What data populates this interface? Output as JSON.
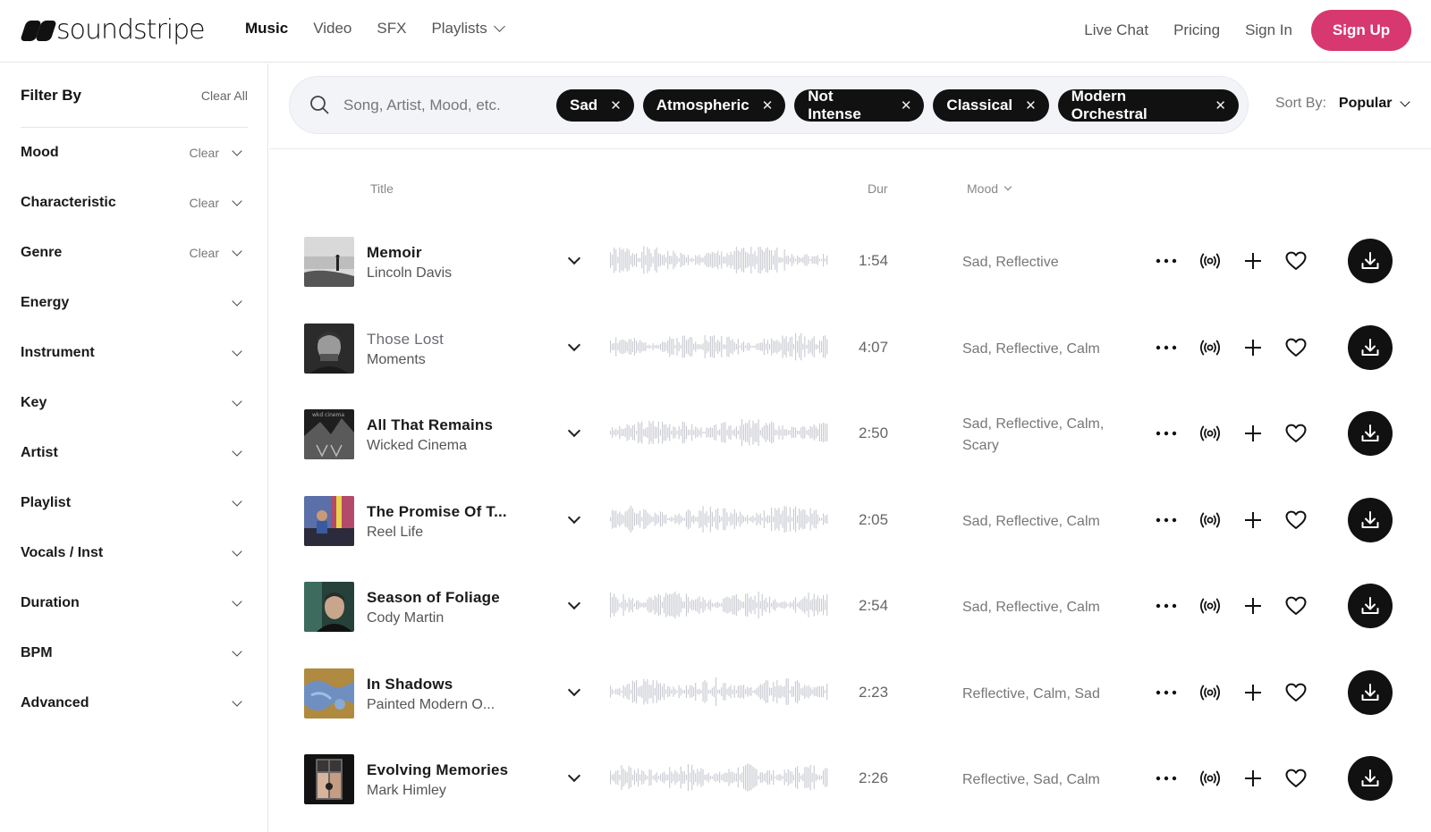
{
  "brand": {
    "name": "soundstripe"
  },
  "nav": {
    "items": [
      "Music",
      "Video",
      "SFX",
      "Playlists"
    ],
    "right": [
      "Live Chat",
      "Pricing",
      "Sign In"
    ],
    "signup": "Sign Up"
  },
  "colors": {
    "accent": "#d6386f",
    "chip": "#111111"
  },
  "sidebar": {
    "title": "Filter By",
    "clear_all": "Clear All",
    "filters": [
      {
        "label": "Mood",
        "clear": "Clear"
      },
      {
        "label": "Characteristic",
        "clear": "Clear"
      },
      {
        "label": "Genre",
        "clear": "Clear"
      },
      {
        "label": "Energy"
      },
      {
        "label": "Instrument"
      },
      {
        "label": "Key"
      },
      {
        "label": "Artist"
      },
      {
        "label": "Playlist"
      },
      {
        "label": "Vocals / Inst"
      },
      {
        "label": "Duration"
      },
      {
        "label": "BPM"
      },
      {
        "label": "Advanced"
      }
    ]
  },
  "search": {
    "placeholder": "Song, Artist, Mood, etc.",
    "chips": [
      "Sad",
      "Atmospheric",
      "Not Intense",
      "Classical",
      "Modern Orchestral"
    ]
  },
  "sort": {
    "label": "Sort By:",
    "value": "Popular"
  },
  "table": {
    "headers": {
      "title": "Title",
      "duration": "Dur",
      "mood": "Mood"
    },
    "rows": [
      {
        "title": "Memoir",
        "artist": "Lincoln Davis",
        "duration": "1:54",
        "mood": "Sad, Reflective",
        "thumb": "landscape"
      },
      {
        "title": "Those Lost",
        "artist": "Moments",
        "duration": "4:07",
        "mood": "Sad, Reflective, Calm",
        "thumb": "portrait-bw",
        "played": true
      },
      {
        "title": "All That Remains",
        "artist": "Wicked Cinema",
        "duration": "2:50",
        "mood": "Sad, Reflective, Calm, Scary",
        "thumb": "dark-art"
      },
      {
        "title": "The Promise Of T...",
        "artist": "Reel Life",
        "duration": "2:05",
        "mood": "Sad, Reflective, Calm",
        "thumb": "piano"
      },
      {
        "title": "Season of Foliage",
        "artist": "Cody Martin",
        "duration": "2:54",
        "mood": "Sad, Reflective, Calm",
        "thumb": "portrait-green"
      },
      {
        "title": "In Shadows",
        "artist": "Painted Modern O...",
        "duration": "2:23",
        "mood": "Reflective, Calm, Sad",
        "thumb": "painting"
      },
      {
        "title": "Evolving Memories",
        "artist": "Mark Himley",
        "duration": "2:26",
        "mood": "Reflective, Sad, Calm",
        "thumb": "window"
      }
    ]
  },
  "icons": [
    "search-icon",
    "more-icon",
    "broadcast-icon",
    "plus-icon",
    "heart-icon",
    "download-icon",
    "chevron-down-icon",
    "close-icon"
  ]
}
